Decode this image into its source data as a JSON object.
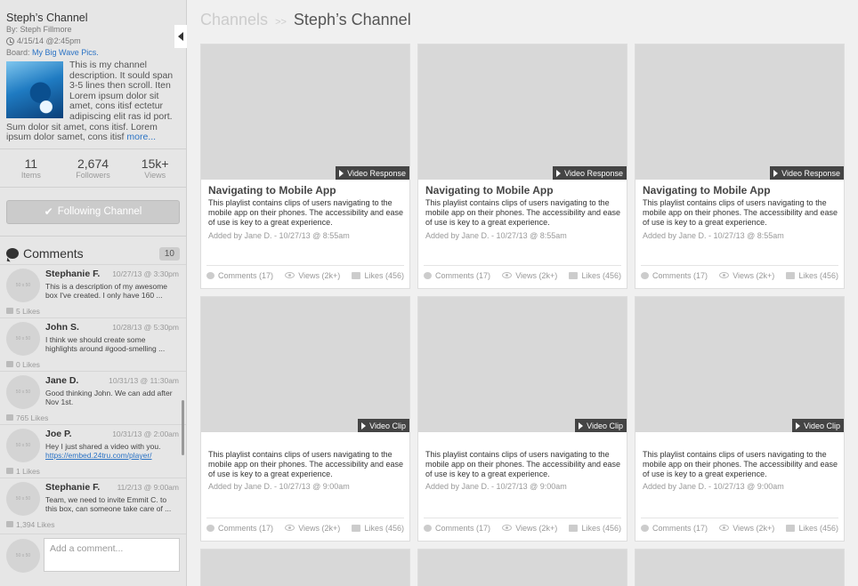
{
  "channel": {
    "title": "Steph’s Channel",
    "by": "By: Steph Fillmore",
    "date": "4/15/14 @2:45pm",
    "board_label": "Board:",
    "board_link": "My Big Wave Pics.",
    "description": "This is my channel description. It sould span 3-5 lines then scroll. Iten Lorem ipsum dolor sit amet, cons itisf ectetur adipiscing elit ras id port. Sum dolor sit amet, cons itisf. Lorem ipsum dolor samet, cons itisf",
    "more_label": "more..."
  },
  "stats": [
    {
      "value": "11",
      "label": "Items"
    },
    {
      "value": "2,674",
      "label": "Followers"
    },
    {
      "value": "15k+",
      "label": "Views"
    }
  ],
  "follow_button": "Following Channel",
  "comments": {
    "title": "Comments",
    "count": "10",
    "avatar_text": "50 x 50",
    "items": [
      {
        "name": "Stephanie F.",
        "time": "10/27/13 @ 3:30pm",
        "text": "This is a description of my awesome box I've created. I only have 160 ...",
        "link": "",
        "likes": "5 Likes"
      },
      {
        "name": "John S.",
        "time": "10/28/13 @ 5:30pm",
        "text": "I think we should create some highlights around #good-smelling ...",
        "link": "",
        "likes": "0 Likes"
      },
      {
        "name": "Jane D.",
        "time": "10/31/13 @ 11:30am",
        "text": "Good thinking John. We can add after Nov 1st.",
        "link": "",
        "likes": "765 Likes"
      },
      {
        "name": "Joe P.",
        "time": "10/31/13 @ 2:00am",
        "text": "Hey I just shared a video with you.",
        "link": "https://embed.24tru.com/player/",
        "likes": "1 Likes"
      },
      {
        "name": "Stephanie F.",
        "time": "11/2/13 @ 9:00am",
        "text": "Team, we need to invite Emmit C. to this box, can someone take care of ...",
        "link": "",
        "likes": "1,394 Likes"
      }
    ],
    "add_placeholder": "Add a comment..."
  },
  "breadcrumb": {
    "parent": "Channels",
    "separator": ">>",
    "current": "Steph’s Channel"
  },
  "cards": [
    {
      "badge": "Video Response",
      "title": "Navigating to Mobile App",
      "body": "This playlist contains clips of users navigating to the mobile app on their phones. The accessibility and ease of use is key to a great experience.",
      "meta": "Added by Jane D. - 10/27/13 @ 8:55am",
      "comments": "Comments (17)",
      "views": "Views (2k+)",
      "likes": "Likes (456)"
    },
    {
      "badge": "Video Response",
      "title": "Navigating to Mobile App",
      "body": "This playlist contains clips of users navigating to the mobile app on their phones. The accessibility and ease of use is key to a great experience.",
      "meta": "Added by Jane D. - 10/27/13 @ 8:55am",
      "comments": "Comments (17)",
      "views": "Views (2k+)",
      "likes": "Likes (456)"
    },
    {
      "badge": "Video Response",
      "title": "Navigating to Mobile App",
      "body": "This playlist contains clips of users navigating to the mobile app on their phones. The accessibility and ease of use is key to a great experience.",
      "meta": "Added by Jane D. - 10/27/13 @ 8:55am",
      "comments": "Comments (17)",
      "views": "Views (2k+)",
      "likes": "Likes (456)"
    },
    {
      "badge": "Video Clip",
      "title": "",
      "body": "This playlist contains clips of users navigating to the mobile app on their phones. The accessibility and ease of use is key to a great experience.",
      "meta": "Added by Jane D. - 10/27/13 @ 9:00am",
      "comments": "Comments (17)",
      "views": "Views (2k+)",
      "likes": "Likes (456)"
    },
    {
      "badge": "Video Clip",
      "title": "",
      "body": "This playlist contains clips of users navigating to the mobile app on their phones. The accessibility and ease of use is key to a great experience.",
      "meta": "Added by Jane D. - 10/27/13 @ 9:00am",
      "comments": "Comments (17)",
      "views": "Views (2k+)",
      "likes": "Likes (456)"
    },
    {
      "badge": "Video Clip",
      "title": "",
      "body": "This playlist contains clips of users navigating to the mobile app on their phones. The accessibility and ease of use is key to a great experience.",
      "meta": "Added by Jane D. - 10/27/13 @ 9:00am",
      "comments": "Comments (17)",
      "views": "Views (2k+)",
      "likes": "Likes (456)"
    }
  ]
}
